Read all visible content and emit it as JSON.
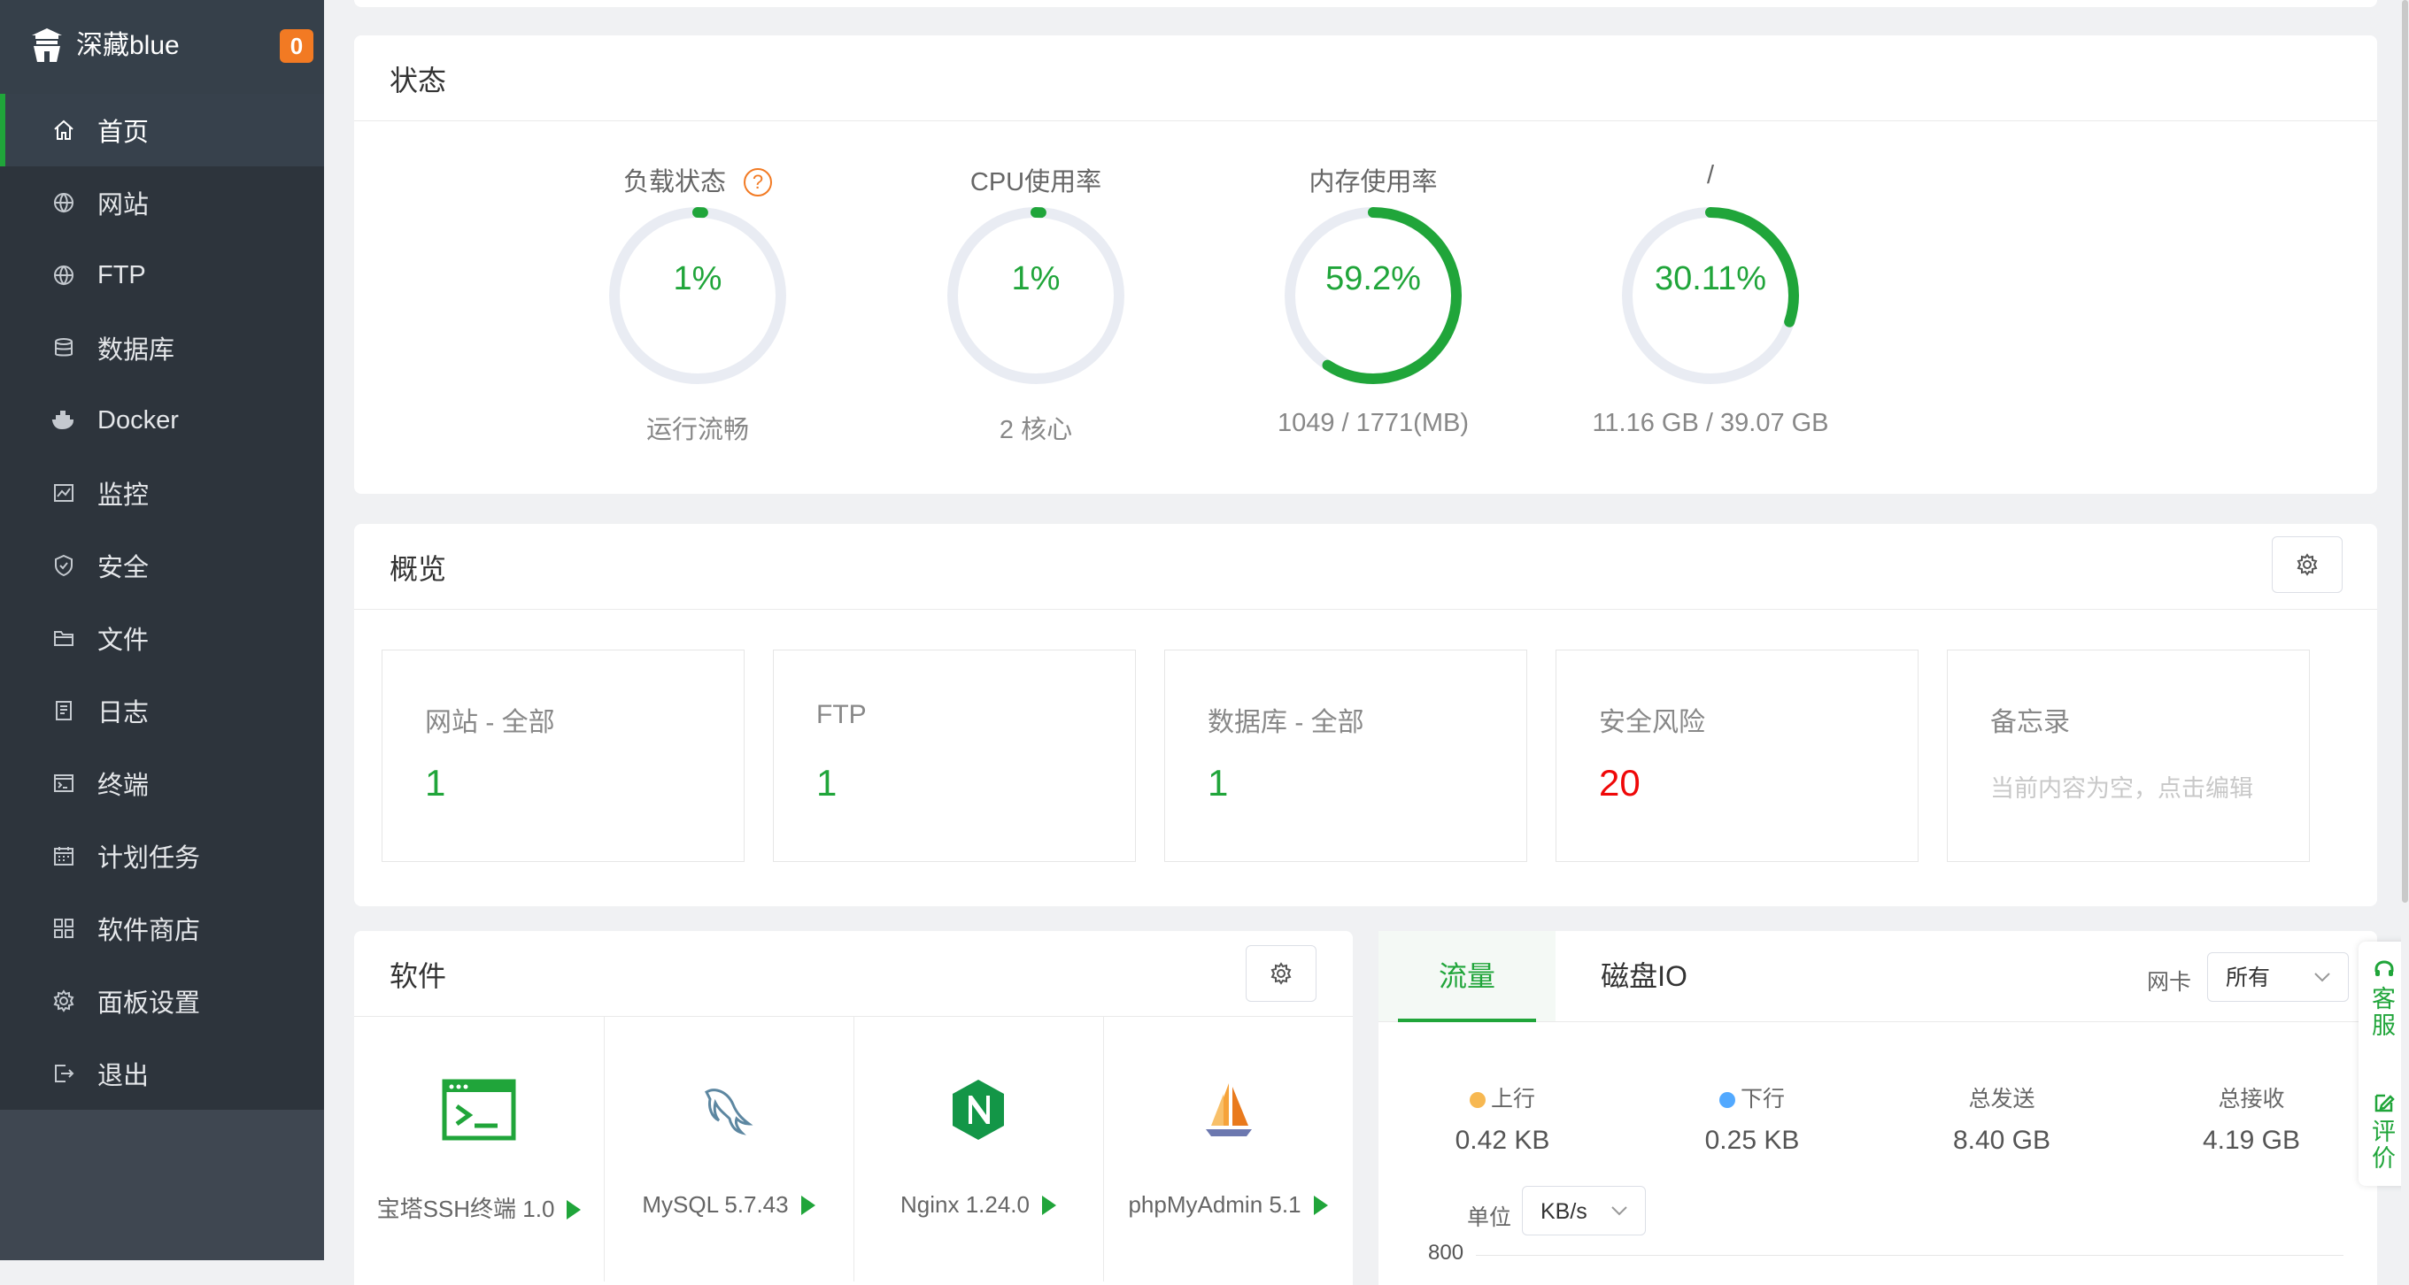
{
  "brand": {
    "name": "深藏blue",
    "badge": "0"
  },
  "nav": [
    {
      "label": "首页",
      "icon": "home-icon",
      "active": true
    },
    {
      "label": "网站",
      "icon": "globe-icon"
    },
    {
      "label": "FTP",
      "icon": "globe-icon"
    },
    {
      "label": "数据库",
      "icon": "database-icon"
    },
    {
      "label": "Docker",
      "icon": "docker-icon"
    },
    {
      "label": "监控",
      "icon": "monitor-icon"
    },
    {
      "label": "安全",
      "icon": "shield-icon"
    },
    {
      "label": "文件",
      "icon": "folder-icon"
    },
    {
      "label": "日志",
      "icon": "log-icon"
    },
    {
      "label": "终端",
      "icon": "terminal-icon"
    },
    {
      "label": "计划任务",
      "icon": "calendar-icon"
    },
    {
      "label": "软件商店",
      "icon": "apps-icon"
    },
    {
      "label": "面板设置",
      "icon": "gear-icon"
    },
    {
      "label": "退出",
      "icon": "logout-icon"
    }
  ],
  "status": {
    "title": "状态",
    "gauges": [
      {
        "label": "负载状态",
        "value": "1%",
        "percent": 1,
        "sub": "运行流畅",
        "help": "?"
      },
      {
        "label": "CPU使用率",
        "value": "1%",
        "percent": 1,
        "sub": "2 核心"
      },
      {
        "label": "内存使用率",
        "value": "59.2%",
        "percent": 59.2,
        "sub": "1049 / 1771(MB)"
      },
      {
        "label": "/",
        "value": "30.11%",
        "percent": 30.11,
        "sub": "11.16 GB / 39.07 GB"
      }
    ]
  },
  "overview": {
    "title": "概览",
    "tiles": [
      {
        "label": "网站 - 全部",
        "value": "1"
      },
      {
        "label": "FTP",
        "value": "1"
      },
      {
        "label": "数据库 - 全部",
        "value": "1"
      },
      {
        "label": "安全风险",
        "value": "20"
      },
      {
        "label": "备忘录",
        "memo": "当前内容为空，点击编辑"
      }
    ]
  },
  "software": {
    "title": "软件",
    "items": [
      {
        "name": "宝塔SSH终端 1.0",
        "icon": "terminal-app-icon"
      },
      {
        "name": "MySQL 5.7.43",
        "icon": "mysql-dolphin-icon"
      },
      {
        "name": "Nginx 1.24.0",
        "icon": "nginx-icon"
      },
      {
        "name": "phpMyAdmin 5.1",
        "icon": "phpmyadmin-sail-icon"
      }
    ]
  },
  "traffic": {
    "tabs": [
      "流量",
      "磁盘IO"
    ],
    "nic_label": "网卡",
    "nic_value": "所有",
    "stats": [
      {
        "label": "上行",
        "value": "0.42 KB",
        "dot": "#f7b851"
      },
      {
        "label": "下行",
        "value": "0.25 KB",
        "dot": "#52a9ff"
      },
      {
        "label": "总发送",
        "value": "8.40 GB"
      },
      {
        "label": "总接收",
        "value": "4.19 GB"
      }
    ],
    "unit_label": "单位",
    "unit_value": "KB/s",
    "axis_top": "800"
  },
  "float": {
    "service": "客服",
    "review": "评价"
  },
  "colors": {
    "accent": "#20a53a",
    "danger": "#ef0808",
    "sidebar": "#3f4751"
  }
}
